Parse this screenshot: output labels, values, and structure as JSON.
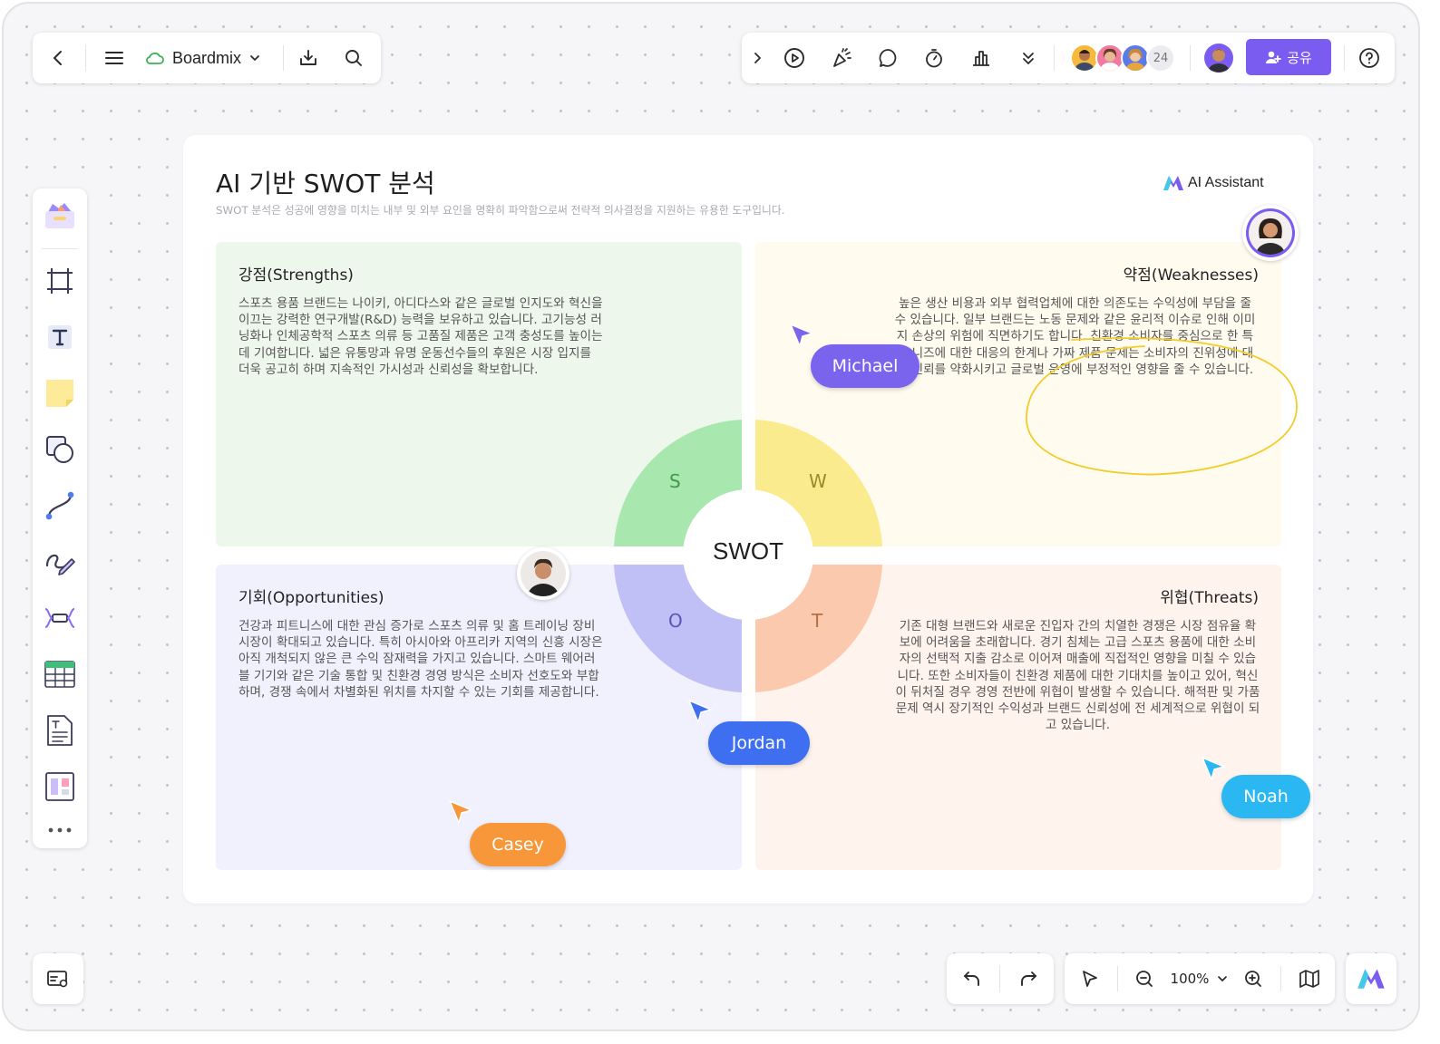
{
  "top_left_toolbar": {
    "app_name": "Boardmix"
  },
  "top_right_toolbar": {
    "collaborator_count": "24",
    "share_label": "공유"
  },
  "board": {
    "title": "AI 기반 SWOT 분석",
    "subtitle": "SWOT 분석은 성공에 영향을 미치는 내부 및 외부 요인을 명확히 파악함으로써 전략적 의사결정을 지원하는 유용한 도구입니다.",
    "ai_badge": "AI Assistant",
    "center_label": "SWOT",
    "quadrants": {
      "strengths": {
        "letter": "S",
        "title": "강점(Strengths)",
        "body": "스포츠 용품 브랜드는 나이키, 아디다스와 같은 글로벌 인지도와 혁신을 이끄는 강력한 연구개발(R&D) 능력을 보유하고 있습니다. 고기능성 러닝화나 인체공학적 스포츠 의류 등 고품질 제품은 고객 충성도를 높이는 데 기여합니다. 넓은 유통망과 유명 운동선수들의 후원은 시장 입지를 더욱 공고히 하며 지속적인 가시성과 신뢰성을 확보합니다."
      },
      "weaknesses": {
        "letter": "W",
        "title": "약점(Weaknesses)",
        "body": "높은 생산 비용과 외부 협력업체에 대한 의존도는 수익성에 부담을 줄 수 있습니다. 일부 브랜드는 노동 문제와 같은 윤리적 이슈로 인해 이미지 손상의 위험에 직면하기도 합니다. 친환경 소비자를 중심으로 한 특정 니즈에 대한 대응의 한계나 가짜 제품 문제는 소비자의 진위성에 대한 신뢰를 약화시키고 글로벌 운영에 부정적인 영향을 줄 수 있습니다."
      },
      "opportunities": {
        "letter": "O",
        "title": "기회(Opportunities)",
        "body": "건강과 피트니스에 대한 관심 증가로 스포츠 의류 및 홈 트레이닝 장비 시장이 확대되고 있습니다. 특히 아시아와 아프리카 지역의 신흥 시장은 아직 개척되지 않은 큰 수익 잠재력을 가지고 있습니다. 스마트 웨어러블 기기와 같은 기술 통합 및 친환경 경영 방식은 소비자 선호도와 부합하며, 경쟁 속에서 차별화된 위치를 차지할 수 있는 기회를 제공합니다."
      },
      "threats": {
        "letter": "T",
        "title": "위협(Threats)",
        "body": "기존 대형 브랜드와 새로운 진입자 간의 치열한 경쟁은 시장 점유율 확보에 어려움을 초래합니다. 경기 침체는 고급 스포츠 용품에 대한 소비자의 선택적 지출 감소로 이어져 매출에 직접적인 영향을 미칠 수 있습니다. 또한 소비자들이 친환경 제품에 대한 기대치를 높이고 있어, 혁신이 뒤처질 경우 경영 전반에 위협이 발생할 수 있습니다. 해적판 및 가품 문제 역시 장기적인 수익성과 브랜드 신뢰성에 전 세계적으로 위협이 되고 있습니다."
      }
    }
  },
  "cursors": {
    "michael": "Michael",
    "jordan": "Jordan",
    "casey": "Casey",
    "noah": "Noah"
  },
  "zoom": {
    "level": "100%"
  },
  "colors": {
    "brand_purple": "#7b5cf0",
    "strengths_bg": "#eef7ec",
    "weaknesses_bg": "#fffbef",
    "opportunities_bg": "#f1f1fd",
    "threats_bg": "#fff3ee",
    "s_segment": "#a8e8ae",
    "w_segment": "#faeb8e",
    "o_segment": "#c0bff6",
    "t_segment": "#fbc9ae",
    "michael": "#7a64ee",
    "jordan": "#3d6ff0",
    "casey": "#f7973a",
    "noah": "#2bb8f2",
    "annotation_stroke": "#f2cc2a"
  }
}
